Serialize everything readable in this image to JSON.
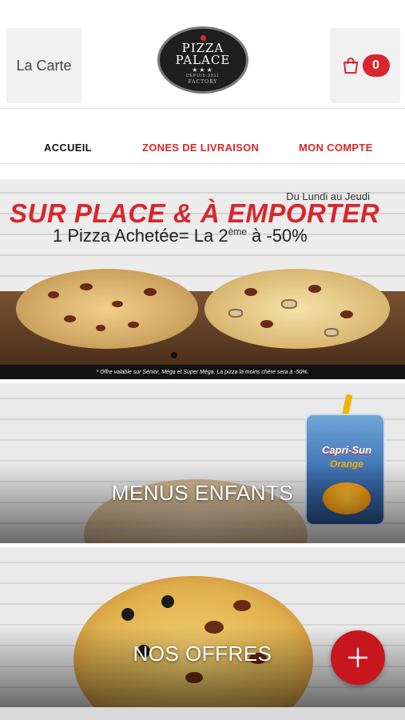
{
  "header": {
    "menu_button_label": "La Carte",
    "logo": {
      "line1": "PIZZA",
      "line2": "PALACE",
      "stars": "★★★",
      "since": "DEPUIS 2011",
      "factory": "FACTORY"
    },
    "cart_count": "0"
  },
  "nav": {
    "items": [
      {
        "label": "ACCUEIL",
        "active": true
      },
      {
        "label": "ZONES DE LIVRAISON",
        "active": false
      },
      {
        "label": "MON COMPTE",
        "active": false
      }
    ]
  },
  "banner": {
    "days": "Du Lundi au Jeudi",
    "headline": "SUR PLACE & À EMPORTER",
    "offer_prefix": "1 Pizza Achetée= La 2",
    "offer_sup": "ème",
    "offer_suffix": " à -50%",
    "disclaimer": "* Offre valable sur Sénior, Méga et Super Méga. La pizza la moins chère sera à -50%."
  },
  "categories": [
    {
      "title": "MENUS ENFANTS",
      "product_brand": "Capri-Sun",
      "product_flavor": "Orange"
    },
    {
      "title": "NOS OFFRES"
    }
  ],
  "fab": {
    "icon": "plus-icon"
  },
  "colors": {
    "accent": "#d9262c",
    "fab": "#c8161e"
  }
}
